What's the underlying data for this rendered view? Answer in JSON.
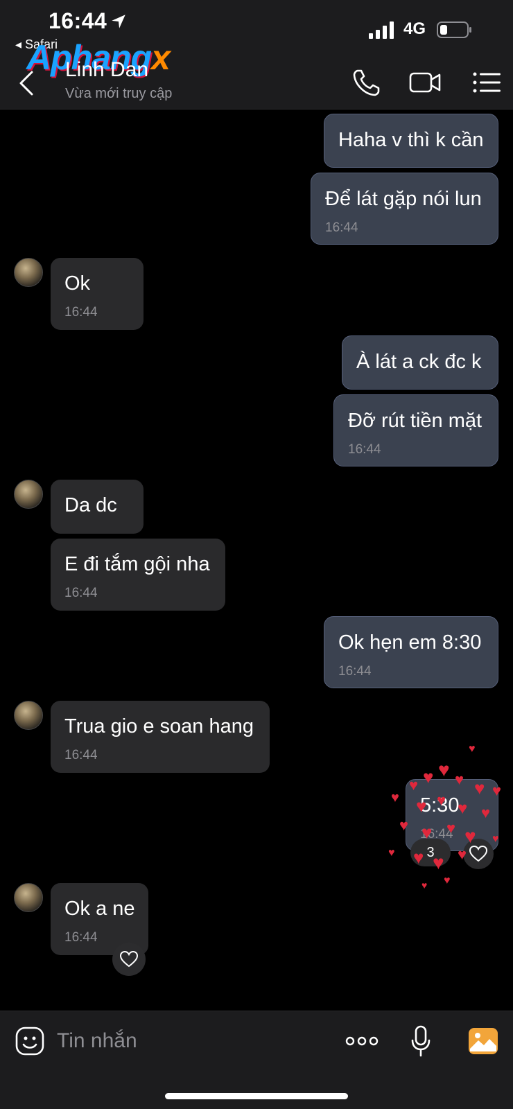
{
  "status_bar": {
    "time": "16:44",
    "back_app": "◂ Safari",
    "network": "4G"
  },
  "watermark": {
    "main": "Aphang",
    "x": "x"
  },
  "header": {
    "contact_name": "Linh Dan",
    "contact_status": "Vừa mới truy cập"
  },
  "messages": [
    {
      "from": "me",
      "text": "Haha v thì k cần",
      "time": ""
    },
    {
      "from": "me",
      "text": "Để lát gặp nói lun",
      "time": "16:44"
    },
    {
      "from": "them",
      "text": "Ok",
      "time": "16:44"
    },
    {
      "from": "me",
      "text": "À lát a ck đc k",
      "time": ""
    },
    {
      "from": "me",
      "text": "Đỡ rút tiền mặt",
      "time": "16:44"
    },
    {
      "from": "them",
      "text": "Da dc",
      "time": ""
    },
    {
      "from": "them",
      "text": "E đi tắm gội nha",
      "time": "16:44"
    },
    {
      "from": "me",
      "text": "Ok hẹn em 8:30",
      "time": "16:44"
    },
    {
      "from": "them",
      "text": "Trua gio e soan hang",
      "time": "16:44"
    },
    {
      "from": "me",
      "text": "5:30",
      "time": "16:44",
      "reaction_count": "3"
    },
    {
      "from": "them",
      "text": "Ok a ne",
      "time": "16:44"
    }
  ],
  "composer": {
    "placeholder": "Tin nhắn"
  },
  "colors": {
    "bubble_me": "#3b4250",
    "bubble_them": "#2a2a2c",
    "accent": "#f2a53a",
    "heart": "#e0283c"
  },
  "icons": [
    "location-arrow-icon",
    "signal-icon",
    "battery-icon",
    "back-chevron-icon",
    "phone-icon",
    "video-icon",
    "menu-icon",
    "heart-icon",
    "emoji-icon",
    "more-icon",
    "mic-icon",
    "image-icon"
  ]
}
